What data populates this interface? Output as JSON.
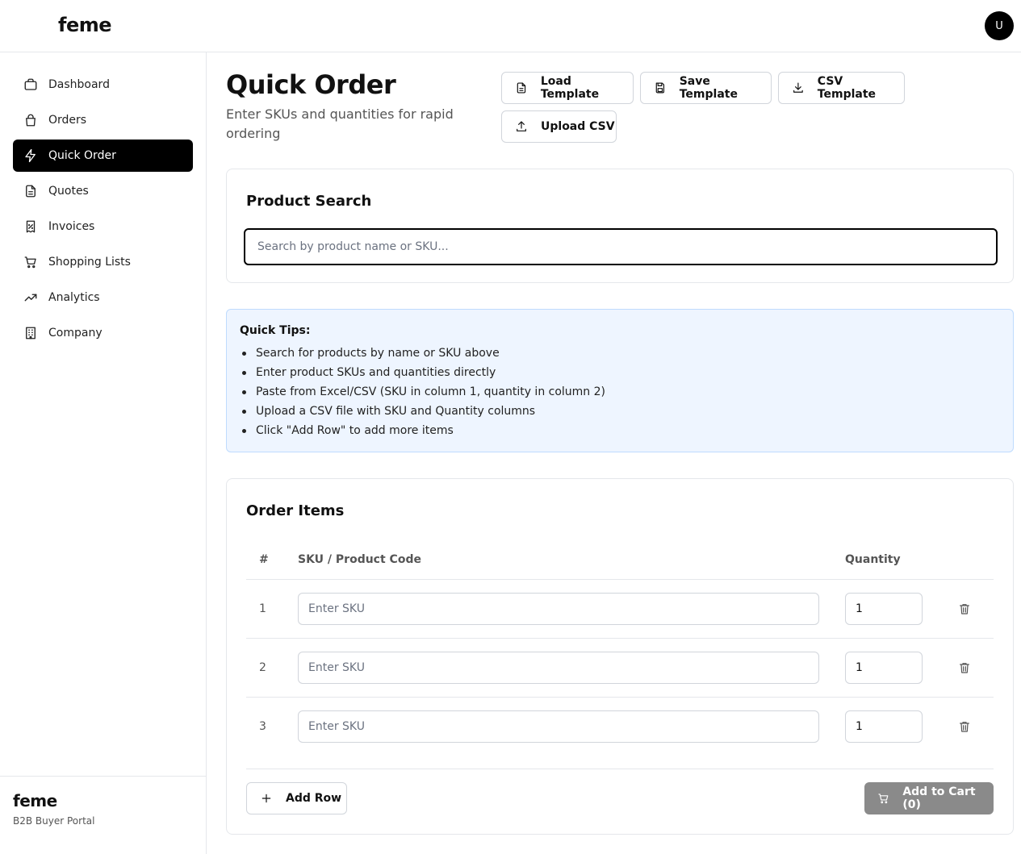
{
  "header": {
    "brand": "feme",
    "avatar_initial": "U"
  },
  "sidebar": {
    "items": [
      {
        "label": "Dashboard",
        "icon": "briefcase-icon",
        "active": false
      },
      {
        "label": "Orders",
        "icon": "shopping-bag-icon",
        "active": false
      },
      {
        "label": "Quick Order",
        "icon": "lightning-icon",
        "active": true
      },
      {
        "label": "Quotes",
        "icon": "document-icon",
        "active": false
      },
      {
        "label": "Invoices",
        "icon": "receipt-percent-icon",
        "active": false
      },
      {
        "label": "Shopping Lists",
        "icon": "cart-icon",
        "active": false
      },
      {
        "label": "Analytics",
        "icon": "trending-up-icon",
        "active": false
      },
      {
        "label": "Company",
        "icon": "building-icon",
        "active": false
      }
    ],
    "footer": {
      "brand": "feme",
      "subtitle": "B2B Buyer Portal"
    }
  },
  "page": {
    "title": "Quick Order",
    "subtitle": "Enter SKUs and quantities for rapid ordering"
  },
  "toolbar": {
    "load_template": "Load Template",
    "save_template": "Save Template",
    "csv_template": "CSV Template",
    "upload_csv": "Upload CSV"
  },
  "product_search": {
    "title": "Product Search",
    "placeholder": "Search by product name or SKU..."
  },
  "tips": {
    "title": "Quick Tips:",
    "items": [
      "Search for products by name or SKU above",
      "Enter product SKUs and quantities directly",
      "Paste from Excel/CSV (SKU in column 1, quantity in column 2)",
      "Upload a CSV file with SKU and Quantity columns",
      "Click \"Add Row\" to add more items"
    ]
  },
  "order_items": {
    "title": "Order Items",
    "columns": {
      "number": "#",
      "sku": "SKU / Product Code",
      "quantity": "Quantity"
    },
    "rows": [
      {
        "number": "1",
        "sku_placeholder": "Enter SKU",
        "quantity": "1"
      },
      {
        "number": "2",
        "sku_placeholder": "Enter SKU",
        "quantity": "1"
      },
      {
        "number": "3",
        "sku_placeholder": "Enter SKU",
        "quantity": "1"
      }
    ],
    "add_row_label": "Add Row",
    "add_to_cart_label": "Add to Cart (0)"
  },
  "colors": {
    "active_nav_bg": "#000000",
    "tips_bg": "#eef5ff",
    "tips_border": "#bfdbfe",
    "add_to_cart_bg": "#8a8a8a"
  }
}
